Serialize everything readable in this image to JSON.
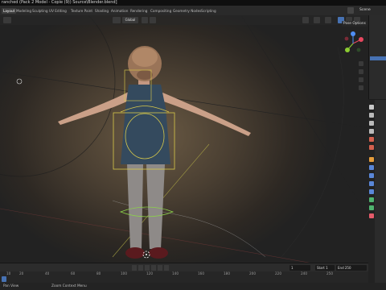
{
  "window": {
    "title": "ranched (Pack 2 Model - Copie (9)) Source\\Blender.blend]"
  },
  "workspace_tabs": [
    "Layout",
    "Modeling",
    "Sculpting",
    "UV Editing",
    "Texture Paint",
    "Shading",
    "Animation",
    "Rendering",
    "Compositing",
    "Geometry Nodes",
    "Scripting"
  ],
  "active_tab": "Layout",
  "scene": {
    "name": "Scene"
  },
  "viewport": {
    "mode_label": "Global",
    "pose_options": "Pose Options"
  },
  "timeline": {
    "ticks": [
      "10",
      "20",
      "40",
      "60",
      "80",
      "100",
      "120",
      "140",
      "160",
      "180",
      "200",
      "220",
      "240",
      "250"
    ],
    "current_frame": "1",
    "start_label": "Start",
    "start_value": "1",
    "end_label": "End",
    "end_value": "250"
  },
  "status": {
    "left": "Pan View",
    "middle": "Zoom Context Menu"
  },
  "colors": {
    "accent": "#4772b3",
    "gizmo_x": "#e8475f",
    "gizmo_y": "#8ccc32",
    "gizmo_z": "#4f8ef5",
    "bone_select": "#d8c94a"
  }
}
